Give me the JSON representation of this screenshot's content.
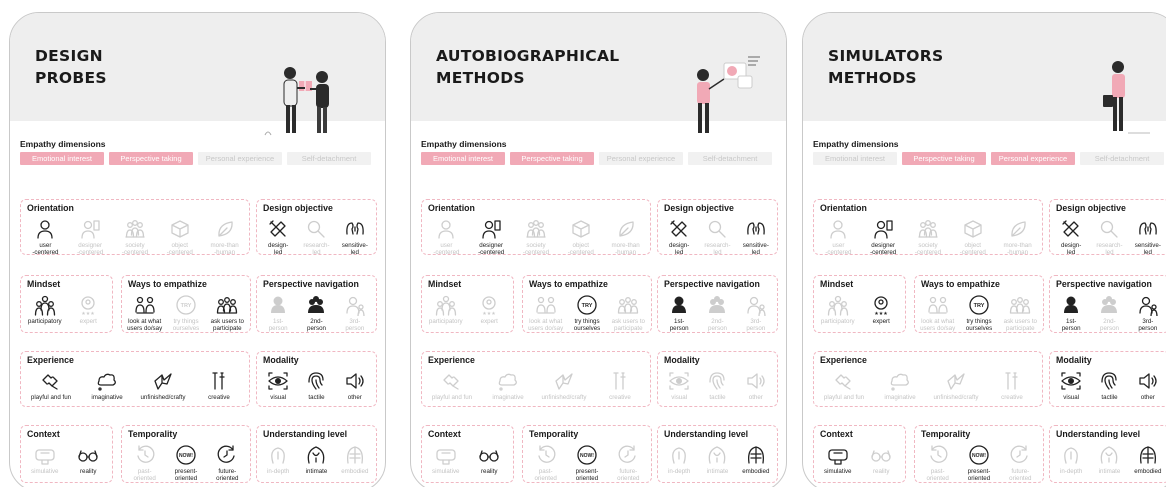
{
  "cards": [
    {
      "title": "DESIGN\nPROBES",
      "empathy_label": "Empathy dimensions",
      "chips": [
        {
          "label": "Emotional interest",
          "active": true
        },
        {
          "label": "Perspective taking",
          "active": true
        },
        {
          "label": "Personal experience",
          "active": false
        },
        {
          "label": "Self-detachment",
          "active": false
        }
      ],
      "sections": {
        "orientation": {
          "title": "Orientation",
          "items": [
            {
              "icon": "user-icon",
              "label": "user\n-centered",
              "active": true
            },
            {
              "icon": "designer-icon",
              "label": "designer\n-centered",
              "active": false
            },
            {
              "icon": "society-icon",
              "label": "society\n-centered",
              "active": false
            },
            {
              "icon": "cube-icon",
              "label": "object\n-centered",
              "active": false
            },
            {
              "icon": "leaf-icon",
              "label": "more-than\n-human",
              "active": false
            }
          ]
        },
        "design_objective": {
          "title": "Design objective",
          "items": [
            {
              "icon": "pencil-ruler-icon",
              "label": "design-\nled",
              "active": true
            },
            {
              "icon": "magnifier-icon",
              "label": "research-\nled",
              "active": false
            },
            {
              "icon": "heads-icon",
              "label": "sensitive-\nled",
              "active": true
            }
          ]
        },
        "mindset": {
          "title": "Mindset",
          "items": [
            {
              "icon": "group-icon",
              "label": "participatory",
              "active": true
            },
            {
              "icon": "expert-icon",
              "label": "expert",
              "active": false
            }
          ]
        },
        "ways": {
          "title": "Ways to empathize",
          "items": [
            {
              "icon": "watch-people-icon",
              "label": "look at what\nusers do/say",
              "active": true
            },
            {
              "icon": "try-icon",
              "label": "try things\nourselves",
              "active": false
            },
            {
              "icon": "ask-users-icon",
              "label": "ask users to\nparticipate",
              "active": true
            }
          ]
        },
        "perspective_navigation": {
          "title": "Perspective navigation",
          "items": [
            {
              "icon": "first-person-icon",
              "label": "1st-\nperson",
              "active": false
            },
            {
              "icon": "second-person-icon",
              "label": "2nd-\nperson",
              "active": true
            },
            {
              "icon": "third-person-icon",
              "label": "3rd-\nperson",
              "active": false
            }
          ]
        },
        "experience": {
          "title": "Experience",
          "items": [
            {
              "icon": "puzzle-icon",
              "label": "playful and fun",
              "active": true
            },
            {
              "icon": "cloud-icon",
              "label": "imaginative",
              "active": true
            },
            {
              "icon": "origami-icon",
              "label": "unfinished/crafty",
              "active": true
            },
            {
              "icon": "tools-icon",
              "label": "creative",
              "active": true
            }
          ]
        },
        "modality": {
          "title": "Modality",
          "items": [
            {
              "icon": "eye-icon",
              "label": "visual",
              "active": true
            },
            {
              "icon": "fingerprint-icon",
              "label": "tactile",
              "active": true
            },
            {
              "icon": "speaker-icon",
              "label": "other",
              "active": true
            }
          ]
        },
        "context": {
          "title": "Context",
          "items": [
            {
              "icon": "vr-icon",
              "label": "simulative",
              "active": false
            },
            {
              "icon": "glasses-icon",
              "label": "reality",
              "active": true
            }
          ]
        },
        "temporality": {
          "title": "Temporality",
          "items": [
            {
              "icon": "past-icon",
              "label": "past-\noriented",
              "active": false
            },
            {
              "icon": "now-icon",
              "label": "present-\noriented",
              "active": true
            },
            {
              "icon": "future-icon",
              "label": "future-\noriented",
              "active": true
            }
          ]
        },
        "understanding": {
          "title": "Understanding level",
          "items": [
            {
              "icon": "head-depth-icon",
              "label": "in-depth",
              "active": false
            },
            {
              "icon": "intimate-icon",
              "label": "intimate",
              "active": true
            },
            {
              "icon": "body-icon",
              "label": "embodied",
              "active": false
            }
          ]
        }
      }
    },
    {
      "title": "AUTOBIOGRAPHICAL\nMETHODS",
      "empathy_label": "Empathy dimensions",
      "chips": [
        {
          "label": "Emotional interest",
          "active": true
        },
        {
          "label": "Perspective taking",
          "active": true
        },
        {
          "label": "Personal experience",
          "active": false
        },
        {
          "label": "Self-detachment",
          "active": false
        }
      ],
      "sections": {
        "orientation": {
          "title": "Orientation",
          "items": [
            {
              "icon": "user-icon",
              "label": "user\n-centered",
              "active": false
            },
            {
              "icon": "designer-icon",
              "label": "designer\n-centered",
              "active": true
            },
            {
              "icon": "society-icon",
              "label": "society\n-centered",
              "active": false
            },
            {
              "icon": "cube-icon",
              "label": "object\n-centered",
              "active": false
            },
            {
              "icon": "leaf-icon",
              "label": "more-than\n-human",
              "active": false
            }
          ]
        },
        "design_objective": {
          "title": "Design objective",
          "items": [
            {
              "icon": "pencil-ruler-icon",
              "label": "design-\nled",
              "active": true
            },
            {
              "icon": "magnifier-icon",
              "label": "research-\nled",
              "active": false
            },
            {
              "icon": "heads-icon",
              "label": "sensitive-\nled",
              "active": true
            }
          ]
        },
        "mindset": {
          "title": "Mindset",
          "items": [
            {
              "icon": "group-icon",
              "label": "participatory",
              "active": false
            },
            {
              "icon": "expert-icon",
              "label": "expert",
              "active": false
            }
          ]
        },
        "ways": {
          "title": "Ways to empathize",
          "items": [
            {
              "icon": "watch-people-icon",
              "label": "look at what\nusers do/say",
              "active": false
            },
            {
              "icon": "try-icon",
              "label": "try things\nourselves",
              "active": true
            },
            {
              "icon": "ask-users-icon",
              "label": "ask users to\nparticipate",
              "active": false
            }
          ]
        },
        "perspective_navigation": {
          "title": "Perspective navigation",
          "items": [
            {
              "icon": "first-person-icon",
              "label": "1st-\nperson",
              "active": true
            },
            {
              "icon": "second-person-icon",
              "label": "2nd-\nperson",
              "active": false
            },
            {
              "icon": "third-person-icon",
              "label": "3rd-\nperson",
              "active": false
            }
          ]
        },
        "experience": {
          "title": "Experience",
          "items": [
            {
              "icon": "puzzle-icon",
              "label": "playful and fun",
              "active": false
            },
            {
              "icon": "cloud-icon",
              "label": "imaginative",
              "active": false
            },
            {
              "icon": "origami-icon",
              "label": "unfinished/crafty",
              "active": false
            },
            {
              "icon": "tools-icon",
              "label": "creative",
              "active": false
            }
          ]
        },
        "modality": {
          "title": "Modality",
          "items": [
            {
              "icon": "eye-icon",
              "label": "visual",
              "active": false
            },
            {
              "icon": "fingerprint-icon",
              "label": "tactile",
              "active": false
            },
            {
              "icon": "speaker-icon",
              "label": "other",
              "active": false
            }
          ]
        },
        "context": {
          "title": "Context",
          "items": [
            {
              "icon": "vr-icon",
              "label": "simulative",
              "active": false
            },
            {
              "icon": "glasses-icon",
              "label": "reality",
              "active": true
            }
          ]
        },
        "temporality": {
          "title": "Temporality",
          "items": [
            {
              "icon": "past-icon",
              "label": "past-\noriented",
              "active": false
            },
            {
              "icon": "now-icon",
              "label": "present-\noriented",
              "active": true
            },
            {
              "icon": "future-icon",
              "label": "future-\noriented",
              "active": false
            }
          ]
        },
        "understanding": {
          "title": "Understanding level",
          "items": [
            {
              "icon": "head-depth-icon",
              "label": "in-depth",
              "active": false
            },
            {
              "icon": "intimate-icon",
              "label": "intimate",
              "active": false
            },
            {
              "icon": "body-icon",
              "label": "embodied",
              "active": true
            }
          ]
        }
      }
    },
    {
      "title": "SIMULATORS\nMETHODS",
      "empathy_label": "Empathy dimensions",
      "chips": [
        {
          "label": "Emotional interest",
          "active": false
        },
        {
          "label": "Perspective taking",
          "active": true
        },
        {
          "label": "Personal experience",
          "active": true
        },
        {
          "label": "Self-detachment",
          "active": false
        }
      ],
      "sections": {
        "orientation": {
          "title": "Orientation",
          "items": [
            {
              "icon": "user-icon",
              "label": "user\n-centered",
              "active": false
            },
            {
              "icon": "designer-icon",
              "label": "designer\n-centered",
              "active": true
            },
            {
              "icon": "society-icon",
              "label": "society\n-centered",
              "active": false
            },
            {
              "icon": "cube-icon",
              "label": "object\n-centered",
              "active": false
            },
            {
              "icon": "leaf-icon",
              "label": "more-than\n-human",
              "active": false
            }
          ]
        },
        "design_objective": {
          "title": "Design objective",
          "items": [
            {
              "icon": "pencil-ruler-icon",
              "label": "design-\nled",
              "active": true
            },
            {
              "icon": "magnifier-icon",
              "label": "research-\nled",
              "active": false
            },
            {
              "icon": "heads-icon",
              "label": "sensitive-\nled",
              "active": true
            }
          ]
        },
        "mindset": {
          "title": "Mindset",
          "items": [
            {
              "icon": "group-icon",
              "label": "participatory",
              "active": false
            },
            {
              "icon": "expert-icon",
              "label": "expert",
              "active": true
            }
          ]
        },
        "ways": {
          "title": "Ways to empathize",
          "items": [
            {
              "icon": "watch-people-icon",
              "label": "look at what\nusers do/say",
              "active": false
            },
            {
              "icon": "try-icon",
              "label": "try things\nourselves",
              "active": true
            },
            {
              "icon": "ask-users-icon",
              "label": "ask users to\nparticipate",
              "active": false
            }
          ]
        },
        "perspective_navigation": {
          "title": "Perspective navigation",
          "items": [
            {
              "icon": "first-person-icon",
              "label": "1st-\nperson",
              "active": true
            },
            {
              "icon": "second-person-icon",
              "label": "2nd-\nperson",
              "active": false
            },
            {
              "icon": "third-person-icon",
              "label": "3rd-\nperson",
              "active": true
            }
          ]
        },
        "experience": {
          "title": "Experience",
          "items": [
            {
              "icon": "puzzle-icon",
              "label": "playful and fun",
              "active": false
            },
            {
              "icon": "cloud-icon",
              "label": "imaginative",
              "active": false
            },
            {
              "icon": "origami-icon",
              "label": "unfinished/crafty",
              "active": false
            },
            {
              "icon": "tools-icon",
              "label": "creative",
              "active": false
            }
          ]
        },
        "modality": {
          "title": "Modality",
          "items": [
            {
              "icon": "eye-icon",
              "label": "visual",
              "active": true
            },
            {
              "icon": "fingerprint-icon",
              "label": "tactile",
              "active": true
            },
            {
              "icon": "speaker-icon",
              "label": "other",
              "active": true
            }
          ]
        },
        "context": {
          "title": "Context",
          "items": [
            {
              "icon": "vr-icon",
              "label": "simulative",
              "active": true
            },
            {
              "icon": "glasses-icon",
              "label": "reality",
              "active": false
            }
          ]
        },
        "temporality": {
          "title": "Temporality",
          "items": [
            {
              "icon": "past-icon",
              "label": "past-\noriented",
              "active": false
            },
            {
              "icon": "now-icon",
              "label": "present-\noriented",
              "active": true
            },
            {
              "icon": "future-icon",
              "label": "future-\noriented",
              "active": false
            }
          ]
        },
        "understanding": {
          "title": "Understanding level",
          "items": [
            {
              "icon": "head-depth-icon",
              "label": "in-depth",
              "active": false
            },
            {
              "icon": "intimate-icon",
              "label": "intimate",
              "active": false
            },
            {
              "icon": "body-icon",
              "label": "embodied",
              "active": true
            }
          ]
        }
      }
    }
  ],
  "icon_glyphs": {
    "try-icon": "TRY",
    "now-icon": "NOW!"
  },
  "colors": {
    "accent_pink": "#f1a9b6",
    "dashed_border": "#f0b7c2",
    "header_gray": "#eeeeee"
  }
}
